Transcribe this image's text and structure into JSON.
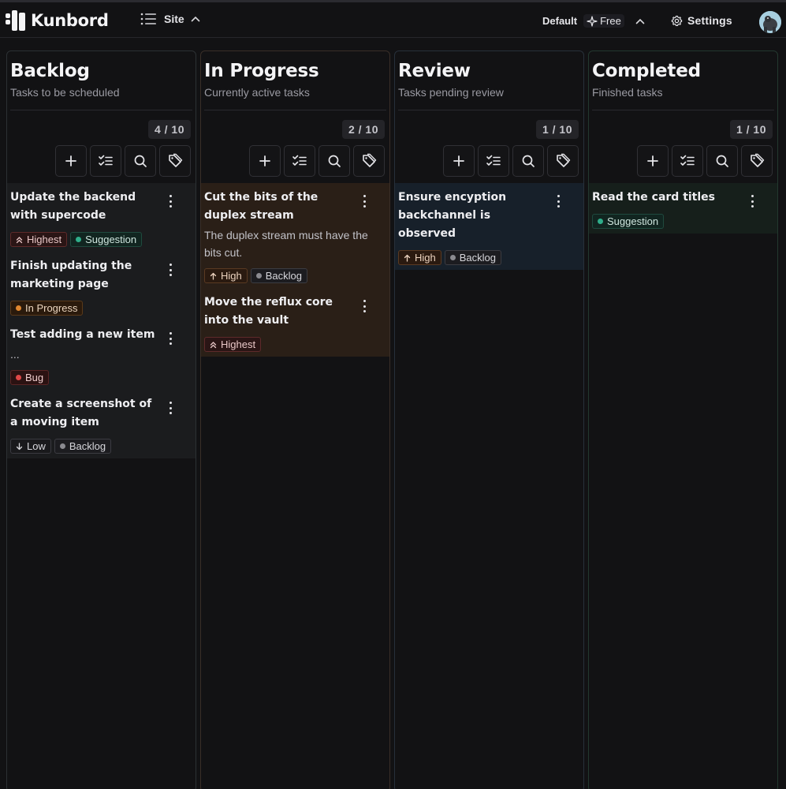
{
  "app": {
    "name": "Kunbord",
    "site_label": "Site",
    "plan_label": "Default",
    "plan_tier": "Free",
    "settings_label": "Settings"
  },
  "colors": {
    "background": "#121214",
    "highest": "#c44a4a",
    "high": "#d9823b",
    "suggestion": "#2fae8a",
    "in_progress": "#e0872f",
    "bug": "#e04848",
    "backlog": "#8a8a90"
  },
  "columns": [
    {
      "title": "Backlog",
      "subtitle": "Tasks to be scheduled",
      "count": "4 / 10",
      "cards": [
        {
          "title": "Update the backend with supercode",
          "tags": [
            {
              "label": "Highest",
              "kind": "prio-highest",
              "icon": "double-chevron-up-icon"
            },
            {
              "label": "Suggestion",
              "kind": "st-suggestion",
              "icon": "dot"
            }
          ]
        },
        {
          "title": "Finish updating the marketing page",
          "tags": [
            {
              "label": "In Progress",
              "kind": "st-progress",
              "icon": "dot"
            }
          ]
        },
        {
          "title": "Test adding a new item",
          "desc": "...",
          "tags": [
            {
              "label": "Bug",
              "kind": "st-bug",
              "icon": "dot"
            }
          ]
        },
        {
          "title": "Create a screenshot of a moving item",
          "tags": [
            {
              "label": "Low",
              "kind": "prio-low",
              "icon": "arrow-down-icon"
            },
            {
              "label": "Backlog",
              "kind": "st-backlog",
              "icon": "dot"
            }
          ]
        }
      ]
    },
    {
      "title": "In Progress",
      "subtitle": "Currently active tasks",
      "count": "2 / 10",
      "cards": [
        {
          "title": "Cut the bits of the duplex stream",
          "desc": "The duplex stream must have the bits cut.",
          "tags": [
            {
              "label": "High",
              "kind": "prio-high",
              "icon": "arrow-up-icon"
            },
            {
              "label": "Backlog",
              "kind": "st-backlog",
              "icon": "dot"
            }
          ]
        },
        {
          "title": "Move the reflux core into the vault",
          "tags": [
            {
              "label": "Highest",
              "kind": "prio-highest",
              "icon": "double-chevron-up-icon"
            }
          ]
        }
      ]
    },
    {
      "title": "Review",
      "subtitle": "Tasks pending review",
      "count": "1 / 10",
      "cards": [
        {
          "title": "Ensure encyption backchannel is observed",
          "tags": [
            {
              "label": "High",
              "kind": "prio-high",
              "icon": "arrow-up-icon"
            },
            {
              "label": "Backlog",
              "kind": "st-backlog",
              "icon": "dot"
            }
          ]
        }
      ]
    },
    {
      "title": "Completed",
      "subtitle": "Finished tasks",
      "count": "1 / 10",
      "cards": [
        {
          "title": "Read the card titles",
          "tags": [
            {
              "label": "Suggestion",
              "kind": "st-suggestion",
              "icon": "dot"
            }
          ]
        }
      ]
    }
  ],
  "tool_icons": [
    "plus-icon",
    "checklist-icon",
    "search-icon",
    "tag-icon"
  ]
}
